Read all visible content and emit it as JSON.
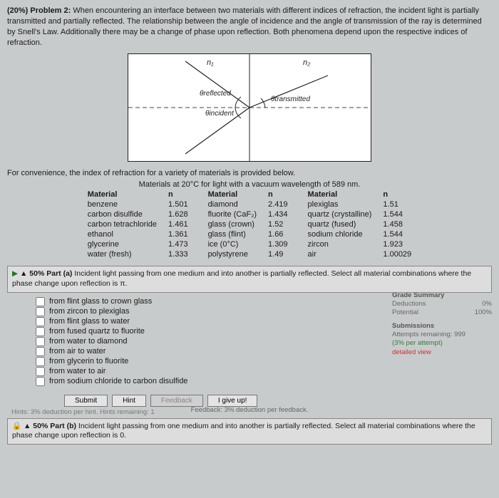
{
  "problem": {
    "title_prefix": "(20%) Problem 2:",
    "body": "When encountering an interface between two materials with different indices of refraction, the incident light is partially transmitted and partially reflected. The relationship between the angle of incidence and the angle of transmission of the ray is determined by Snell's Law. Additionally there may be a change of phase upon reflection. Both phenomena depend upon the respective indices of refraction."
  },
  "diagram": {
    "n1": "n₁",
    "n2": "n₂",
    "theta_r": "θreflected",
    "theta_i": "θincident",
    "theta_t": "θtransmitted"
  },
  "convenience": "For convenience, the index of refraction for a variety of materials is provided below.",
  "table": {
    "title": "Materials at 20°C for light with a vacuum wavelength of 589 nm.",
    "headers": {
      "material": "Material",
      "n": "n"
    },
    "col1": [
      {
        "mat": "benzene",
        "n": "1.501"
      },
      {
        "mat": "carbon disulfide",
        "n": "1.628"
      },
      {
        "mat": "carbon tetrachloride",
        "n": "1.461"
      },
      {
        "mat": "ethanol",
        "n": "1.361"
      },
      {
        "mat": "glycerine",
        "n": "1.473"
      },
      {
        "mat": "water (fresh)",
        "n": "1.333"
      }
    ],
    "col2": [
      {
        "mat": "diamond",
        "n": "2.419"
      },
      {
        "mat": "fluorite (CaF₂)",
        "n": "1.434"
      },
      {
        "mat": "glass (crown)",
        "n": "1.52"
      },
      {
        "mat": "glass (flint)",
        "n": "1.66"
      },
      {
        "mat": "ice (0°C)",
        "n": "1.309"
      },
      {
        "mat": "polystyrene",
        "n": "1.49"
      }
    ],
    "col3": [
      {
        "mat": "plexiglas",
        "n": "1.51"
      },
      {
        "mat": "quartz (crystalline)",
        "n": "1.544"
      },
      {
        "mat": "quartz (fused)",
        "n": "1.458"
      },
      {
        "mat": "sodium chloride",
        "n": "1.544"
      },
      {
        "mat": "zircon",
        "n": "1.923"
      },
      {
        "mat": "air",
        "n": "1.00029"
      }
    ]
  },
  "partA": {
    "header": "▲ 50% Part (a)",
    "text": "Incident light passing from one medium and into another is partially reflected. Select all material combinations where the phase change upon reflection is π.",
    "options": [
      "from flint glass to crown glass",
      "from zircon to plexiglas",
      "from flint glass to water",
      "from fused quartz to fluorite",
      "from water to diamond",
      "from air to water",
      "from glycerin to fluorite",
      "from water to air",
      "from sodium chloride to carbon disulfide"
    ]
  },
  "summary": {
    "title": "Grade Summary",
    "deductions_label": "Deductions",
    "deductions_val": "0%",
    "potential_label": "Potential",
    "potential_val": "100%",
    "subs_title": "Submissions",
    "attempts": "Attempts remaining: 999",
    "perattempt": "(3% per attempt)",
    "detailed": "detailed view"
  },
  "buttons": {
    "submit": "Submit",
    "hint": "Hint",
    "feedback": "Feedback",
    "giveup": "I give up!"
  },
  "hints_line": "Hints: 3% deduction per hint. Hints remaining: 1",
  "feedback_line": "Feedback: 3% deduction per feedback.",
  "partB": {
    "header": "▲ 50% Part (b)",
    "text": "Incident light passing from one medium and into another is partially reflected. Select all material combinations where the phase change upon reflection is 0."
  }
}
